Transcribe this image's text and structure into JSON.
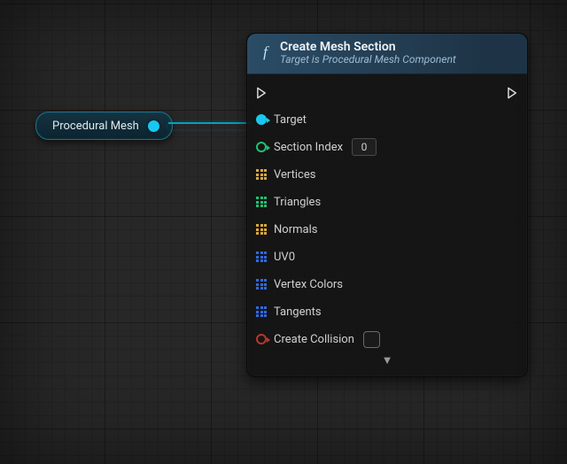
{
  "variable_node": {
    "label": "Procedural Mesh"
  },
  "function_node": {
    "title": "Create Mesh Section",
    "subtitle": "Target is Procedural Mesh Component",
    "pins": {
      "target": {
        "label": "Target"
      },
      "section_index": {
        "label": "Section Index",
        "value": "0"
      },
      "vertices": {
        "label": "Vertices"
      },
      "triangles": {
        "label": "Triangles"
      },
      "normals": {
        "label": "Normals"
      },
      "uv0": {
        "label": "UV0"
      },
      "vertex_colors": {
        "label": "Vertex Colors"
      },
      "tangents": {
        "label": "Tangents"
      },
      "create_collision": {
        "label": "Create Collision"
      }
    }
  }
}
